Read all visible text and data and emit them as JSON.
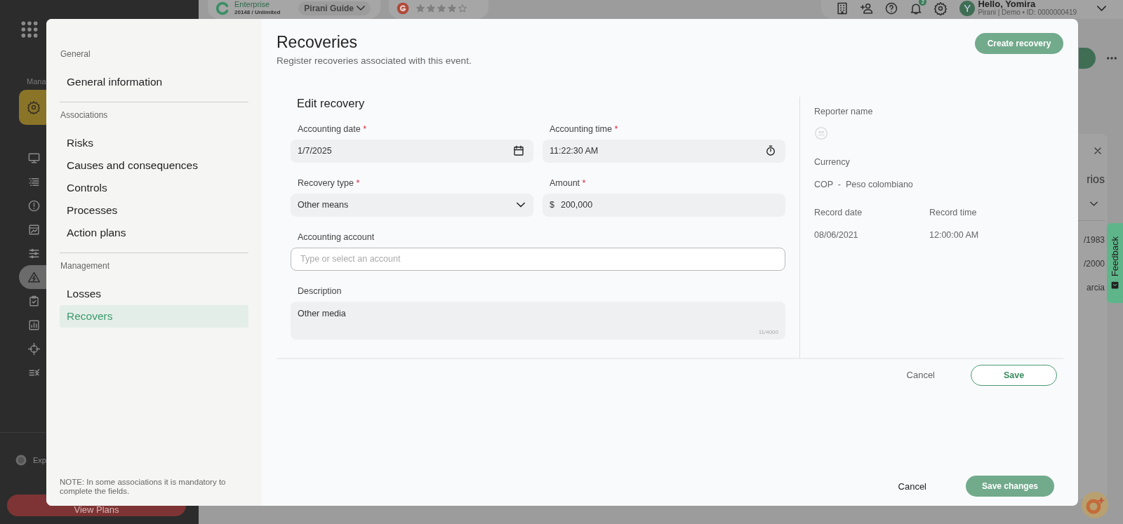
{
  "topbar": {
    "plan": {
      "name": "Enterprise",
      "usage": "20148 / Unlimited"
    },
    "guide": "Pirani Guide",
    "rating": {
      "stars": 4
    },
    "notifications": "2",
    "user": {
      "initial": "Y",
      "greeting": "Hello, Yomira",
      "detail": "Pirani | Demo • ID: 0000000419"
    }
  },
  "sidebar": {
    "section": "Mana",
    "items": [
      {
        "selected": false
      },
      {
        "selected": false
      },
      {
        "selected": false
      },
      {
        "selected": false
      },
      {
        "selected": false
      },
      {
        "selected": true
      },
      {
        "selected": false
      },
      {
        "selected": false
      },
      {
        "selected": false
      },
      {
        "selected": false
      }
    ],
    "expand": "Exp",
    "plans_button": "View Plans"
  },
  "background_panel": {
    "heading": "rios",
    "cells": [
      "/1983",
      "/2000",
      "arcia"
    ]
  },
  "feedback": "Feedback",
  "modal": {
    "nav": {
      "sections": [
        {
          "title": "General",
          "items": [
            {
              "label": "General information",
              "selected": false
            }
          ]
        },
        {
          "title": "Associations",
          "items": [
            {
              "label": "Risks",
              "selected": false
            },
            {
              "label": "Causes and consequences",
              "selected": false
            },
            {
              "label": "Controls",
              "selected": false
            },
            {
              "label": "Processes",
              "selected": false
            },
            {
              "label": "Action plans",
              "selected": false
            }
          ]
        },
        {
          "title": "Management",
          "items": [
            {
              "label": "Losses",
              "selected": false
            },
            {
              "label": "Recovers",
              "selected": true
            }
          ]
        }
      ],
      "note": "NOTE: In some associations it is mandatory to complete the fields."
    },
    "title": "Recoveries",
    "subtitle": "Register recoveries associated with this event.",
    "create_button": {
      "label": "Create recovery",
      "disabled": true
    },
    "form": {
      "title": "Edit recovery",
      "fields": [
        {
          "kind": "date",
          "label": "Accounting date",
          "mark": "*",
          "value": "1/7/2025"
        },
        {
          "kind": "time",
          "label": "Accounting time",
          "mark": "*",
          "value": "11:22:30 AM"
        },
        {
          "kind": "select",
          "label": "Recovery type",
          "mark": "*",
          "value": "Other means"
        },
        {
          "kind": "amount",
          "label": "Amount",
          "mark": "*",
          "prefix": "$",
          "value": "200,000"
        },
        {
          "kind": "text",
          "label": "Accounting account",
          "placeholder": "Type or select an account"
        },
        {
          "kind": "textarea",
          "label": "Description",
          "value": "Other media",
          "counter": "11/4000"
        }
      ],
      "cancel": "Cancel",
      "save": "Save"
    },
    "details": {
      "reporter_label": "Reporter name",
      "currency_label": "Currency",
      "currency": "COP  -  Peso colombiano",
      "records": [
        {
          "label": "Record date",
          "value": "08/06/2021"
        },
        {
          "label": "Record time",
          "value": "12:00:00 AM"
        }
      ]
    },
    "footer": {
      "cancel": "Cancel",
      "save": {
        "label": "Save changes",
        "disabled": true
      }
    }
  }
}
